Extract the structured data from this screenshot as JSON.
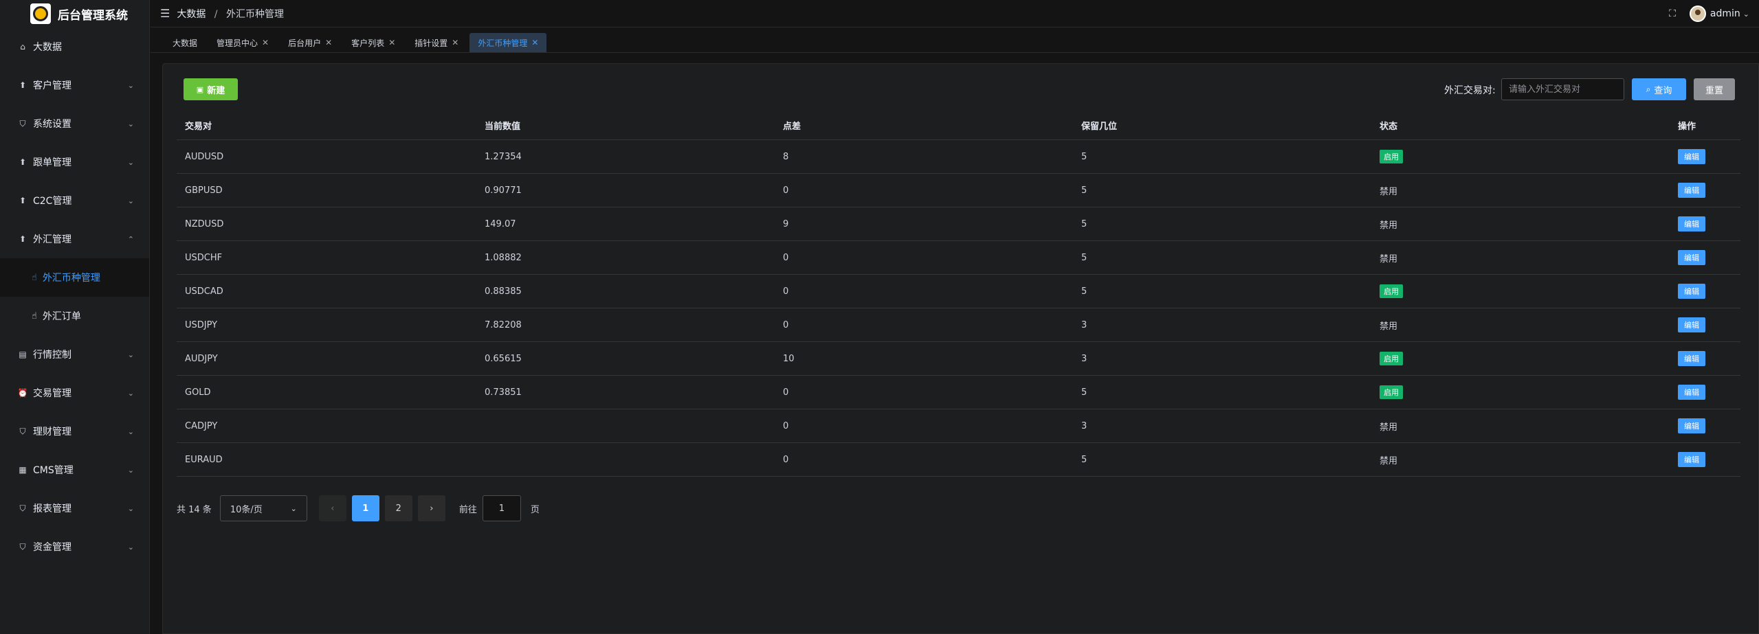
{
  "app": {
    "title": "后台管理系统"
  },
  "sidebar": {
    "items": [
      {
        "label": "大数据",
        "icon": "home-icon",
        "has_children": false
      },
      {
        "label": "客户管理",
        "icon": "arrow-up-circle-icon",
        "has_children": true
      },
      {
        "label": "系统设置",
        "icon": "shield-icon",
        "has_children": true
      },
      {
        "label": "跟单管理",
        "icon": "arrow-up-circle-icon",
        "has_children": true
      },
      {
        "label": "C2C管理",
        "icon": "arrow-up-circle-icon",
        "has_children": true
      },
      {
        "label": "外汇管理",
        "icon": "arrow-up-circle-icon",
        "has_children": true,
        "expanded": true,
        "children": [
          {
            "label": "外汇币种管理",
            "icon": "hand-icon",
            "active": true
          },
          {
            "label": "外汇订单",
            "icon": "hand-icon",
            "active": false
          }
        ]
      },
      {
        "label": "行情控制",
        "icon": "document-icon",
        "has_children": true
      },
      {
        "label": "交易管理",
        "icon": "alarm-clock-icon",
        "has_children": true
      },
      {
        "label": "理财管理",
        "icon": "shield-icon",
        "has_children": true
      },
      {
        "label": "CMS管理",
        "icon": "layout-icon",
        "has_children": true
      },
      {
        "label": "报表管理",
        "icon": "shield-icon",
        "has_children": true
      },
      {
        "label": "资金管理",
        "icon": "shield-icon",
        "has_children": true
      }
    ]
  },
  "header": {
    "breadcrumb": [
      "大数据",
      "外汇币种管理"
    ],
    "breadcrumb_sep": "/",
    "user": "admin"
  },
  "tags": [
    {
      "label": "大数据",
      "closable": false,
      "active": false
    },
    {
      "label": "管理员中心",
      "closable": true,
      "active": false
    },
    {
      "label": "后台用户",
      "closable": true,
      "active": false
    },
    {
      "label": "客户列表",
      "closable": true,
      "active": false
    },
    {
      "label": "插针设置",
      "closable": true,
      "active": false
    },
    {
      "label": "外汇币种管理",
      "closable": true,
      "active": true
    }
  ],
  "toolbar": {
    "new_label": "新建",
    "search_label": "外汇交易对:",
    "search_placeholder": "请输入外汇交易对",
    "search_value": "",
    "query_label": "查询",
    "reset_label": "重置"
  },
  "table": {
    "columns": [
      "交易对",
      "当前数值",
      "点差",
      "保留几位",
      "状态",
      "操作"
    ],
    "rows": [
      {
        "pair": "AUDUSD",
        "value": "1.27354",
        "spread": "8",
        "decimals": "5",
        "status": "启用",
        "enabled": true,
        "action": "编辑"
      },
      {
        "pair": "GBPUSD",
        "value": "0.90771",
        "spread": "0",
        "decimals": "5",
        "status": "禁用",
        "enabled": false,
        "action": "编辑"
      },
      {
        "pair": "NZDUSD",
        "value": "149.07",
        "spread": "9",
        "decimals": "5",
        "status": "禁用",
        "enabled": false,
        "action": "编辑"
      },
      {
        "pair": "USDCHF",
        "value": "1.08882",
        "spread": "0",
        "decimals": "5",
        "status": "禁用",
        "enabled": false,
        "action": "编辑"
      },
      {
        "pair": "USDCAD",
        "value": "0.88385",
        "spread": "0",
        "decimals": "5",
        "status": "启用",
        "enabled": true,
        "action": "编辑"
      },
      {
        "pair": "USDJPY",
        "value": "7.82208",
        "spread": "0",
        "decimals": "3",
        "status": "禁用",
        "enabled": false,
        "action": "编辑"
      },
      {
        "pair": "AUDJPY",
        "value": "0.65615",
        "spread": "10",
        "decimals": "3",
        "status": "启用",
        "enabled": true,
        "action": "编辑"
      },
      {
        "pair": "GOLD",
        "value": "0.73851",
        "spread": "0",
        "decimals": "5",
        "status": "启用",
        "enabled": true,
        "action": "编辑"
      },
      {
        "pair": "CADJPY",
        "value": "",
        "spread": "0",
        "decimals": "3",
        "status": "禁用",
        "enabled": false,
        "action": "编辑"
      },
      {
        "pair": "EURAUD",
        "value": "",
        "spread": "0",
        "decimals": "5",
        "status": "禁用",
        "enabled": false,
        "action": "编辑"
      }
    ]
  },
  "pagination": {
    "total_text": "共 14 条",
    "page_size": "10条/页",
    "pages": [
      "1",
      "2"
    ],
    "current_page": "1",
    "goto_label": "前往",
    "goto_value": "1",
    "goto_suffix": "页"
  },
  "colors": {
    "accent": "#409eff",
    "success": "#67c23a",
    "status_on": "#13b36a",
    "background": "#141414",
    "panel": "#1d1e1f"
  }
}
